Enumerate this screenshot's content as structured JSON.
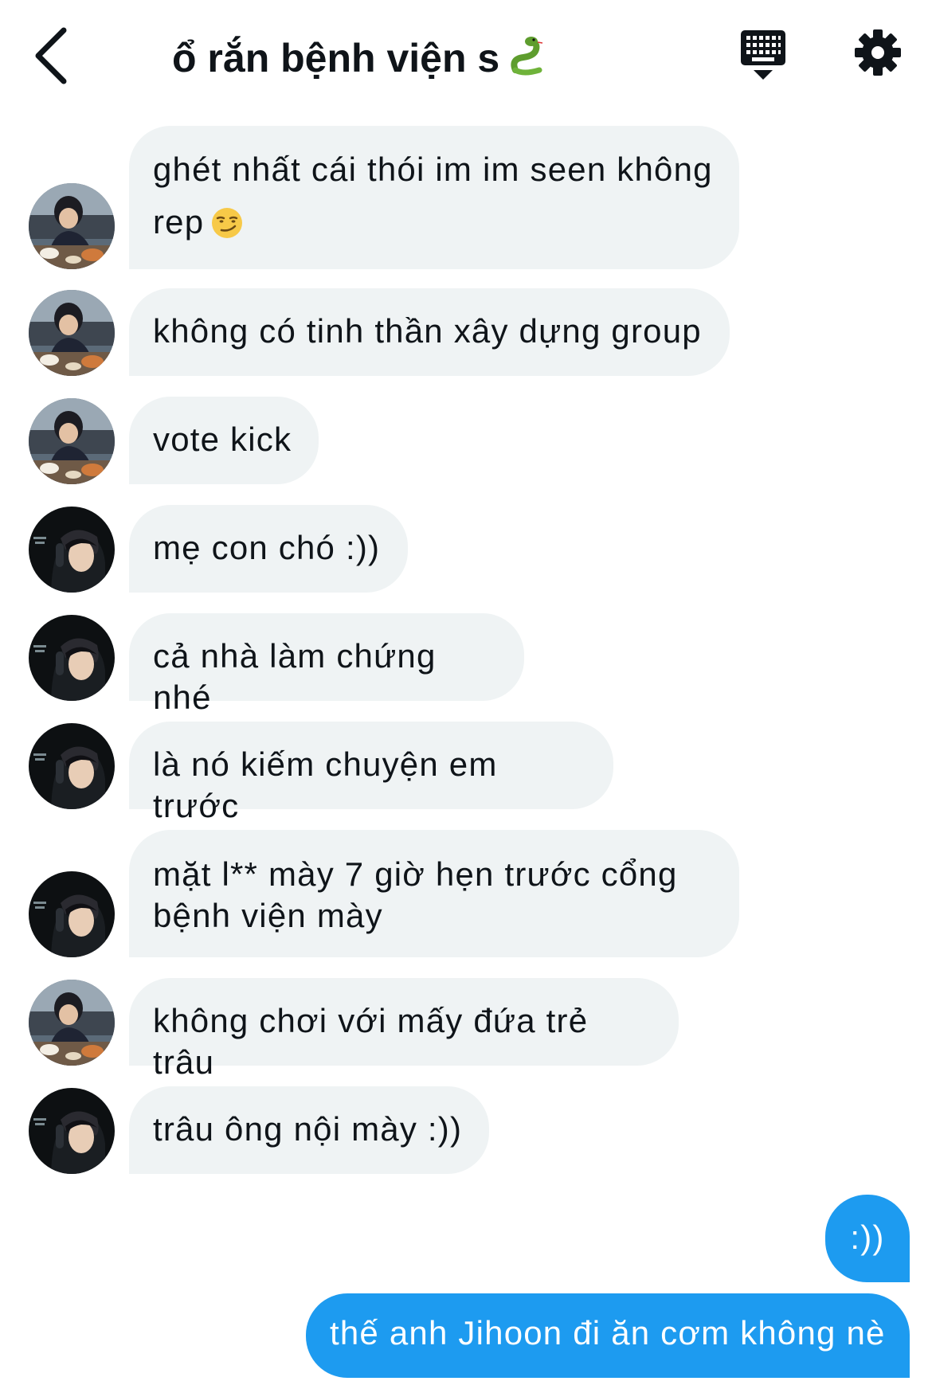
{
  "header": {
    "title": "ổ rắn bệnh viện s",
    "title_emoji": "snake-emoji",
    "back_icon": "chevron-left-icon",
    "keyboard_icon": "keyboard-icon",
    "settings_icon": "gear-icon"
  },
  "messages": [
    {
      "sender": "avatar-a",
      "text": "ghét nhất cái thói im im seen không rep",
      "emoji": "smirk-emoji"
    },
    {
      "sender": "avatar-a",
      "text": "không có tinh thần xây dựng group"
    },
    {
      "sender": "avatar-a",
      "text": "vote kick"
    },
    {
      "sender": "avatar-b",
      "text": "mẹ con chó :))"
    },
    {
      "sender": "avatar-b",
      "text": "cả nhà làm chứng nhé"
    },
    {
      "sender": "avatar-b",
      "text": "là nó kiếm chuyện em trước"
    },
    {
      "sender": "avatar-b",
      "text": "mặt l** mày 7 giờ hẹn trước cổng bệnh viện mày"
    },
    {
      "sender": "avatar-a",
      "text": "không chơi với mấy đứa trẻ trâu"
    },
    {
      "sender": "avatar-b",
      "text": "trâu ông nội mày :))"
    }
  ],
  "outgoing": [
    {
      "text": ":))"
    },
    {
      "text": "thế anh Jihoon đi ăn cơm không nè"
    }
  ],
  "colors": {
    "incoming_bubble": "#eff3f4",
    "outgoing_bubble": "#1d9bf0",
    "text": "#0f1419"
  }
}
